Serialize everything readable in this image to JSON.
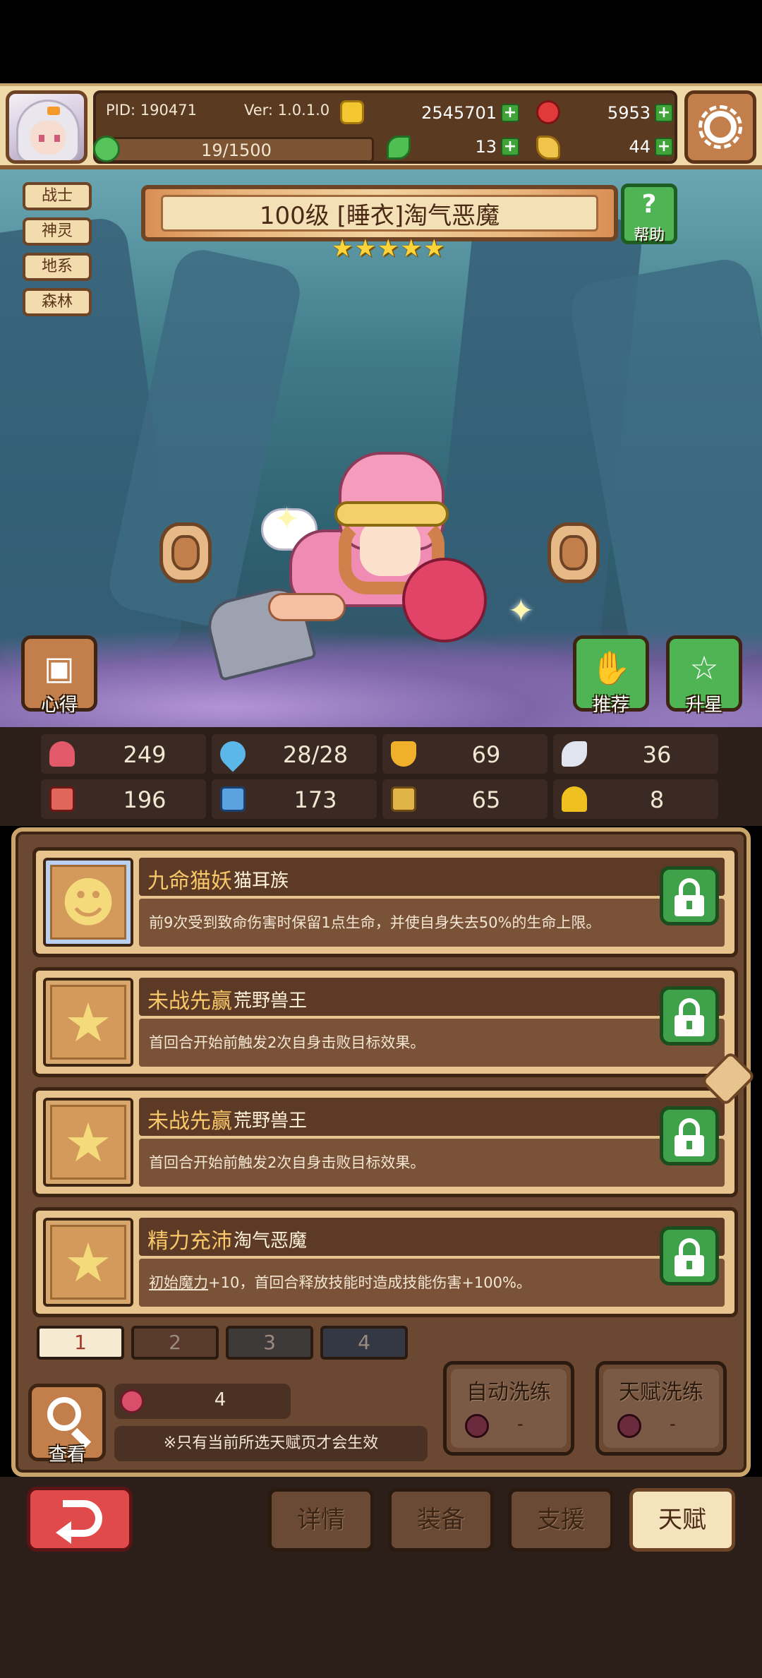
{
  "header": {
    "pid": "PID: 190471",
    "version": "Ver: 1.0.1.0",
    "gold": "2545701",
    "gems": "5953",
    "energy": "19/1500",
    "clovers": "13",
    "horns": "44"
  },
  "hero": {
    "tags": [
      "战士",
      "神灵",
      "地系",
      "森林"
    ],
    "title": "100级 [睡衣]淘气恶魔",
    "stars": 5,
    "help_label": "帮助",
    "help_glyph": "?",
    "left_button": "心得",
    "recommend_button": "推荐",
    "upstar_button": "升星"
  },
  "stats": [
    {
      "icon": "heart-icon",
      "value": "249",
      "color": "#e25a6a"
    },
    {
      "icon": "drop-icon",
      "value": "28/28",
      "color": "#5ab7e8"
    },
    {
      "icon": "shield-icon",
      "value": "69",
      "color": "#f0b02a"
    },
    {
      "icon": "wing-icon",
      "value": "36",
      "color": "#dfe4ef"
    },
    {
      "icon": "fist-icon",
      "value": "196",
      "color": "#e0655a"
    },
    {
      "icon": "book-icon",
      "value": "173",
      "color": "#5aa2e0"
    },
    {
      "icon": "scroll-icon",
      "value": "65",
      "color": "#e1b44a"
    },
    {
      "icon": "horseshoe-icon",
      "value": "8",
      "color": "#f0c020"
    }
  ],
  "talents": [
    {
      "name": "九命猫妖",
      "race": "猫耳族",
      "desc_pre": "",
      "desc_link": "",
      "desc": "前9次受到致命伤害时保留1点生命，并使自身失去50%的生命上限。",
      "icon": "cat-icon"
    },
    {
      "name": "未战先赢",
      "race": "荒野兽王",
      "desc_pre": "",
      "desc_link": "",
      "desc": "首回合开始前触发2次自身击败目标效果。",
      "icon": "star-icon"
    },
    {
      "name": "未战先赢",
      "race": "荒野兽王",
      "desc_pre": "",
      "desc_link": "",
      "desc": "首回合开始前触发2次自身击败目标效果。",
      "icon": "star-icon"
    },
    {
      "name": "精力充沛",
      "race": "淘气恶魔",
      "desc_pre": "",
      "desc_link": "初始魔力",
      "desc": "+10，首回合释放技能时造成技能伤害+100%。",
      "icon": "star-icon"
    }
  ],
  "pages": [
    "1",
    "2",
    "3",
    "4"
  ],
  "active_page": "1",
  "bottom": {
    "view_label": "查看",
    "count": "4",
    "notice": "※只有当前所选天赋页才会生效",
    "auto_reset": "自动洗练",
    "talent_reset": "天赋洗练",
    "cost": "-"
  },
  "nav": {
    "details": "详情",
    "equipment": "装备",
    "support": "支援",
    "talent": "天赋"
  }
}
